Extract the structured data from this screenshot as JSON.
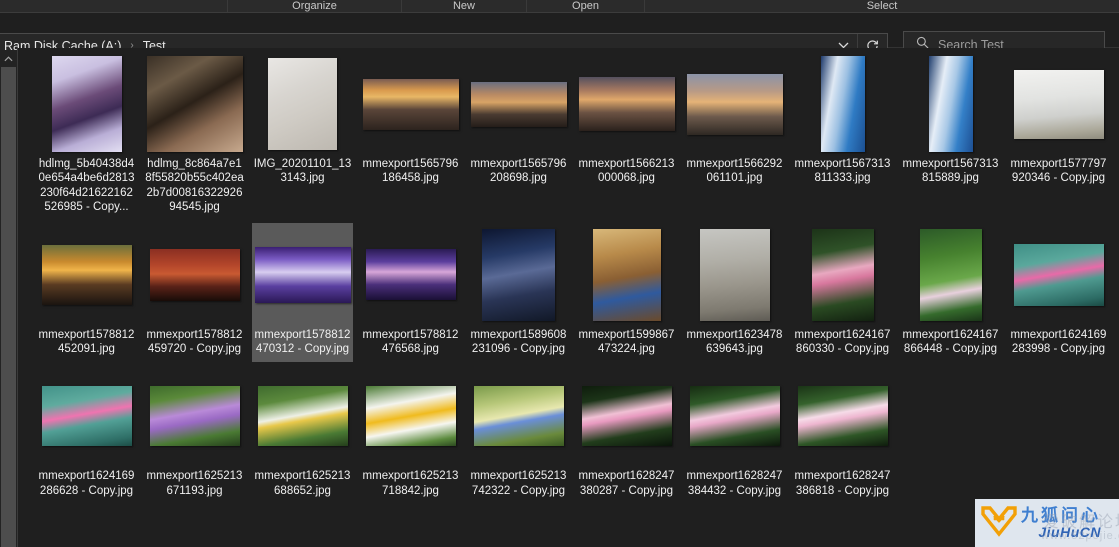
{
  "ribbon": {
    "groups": [
      {
        "label": "",
        "name": "ribbon-group-clipboard"
      },
      {
        "label": "Organize",
        "name": "ribbon-group-organize"
      },
      {
        "label": "New",
        "name": "ribbon-group-new"
      },
      {
        "label": "Open",
        "name": "ribbon-group-open"
      },
      {
        "label": "Select",
        "name": "ribbon-group-select"
      }
    ]
  },
  "address": {
    "crumbs": [
      "Ram Disk Cache (A:)",
      "Test"
    ],
    "separator": "›",
    "dropdown_icon": "chevron-down-icon",
    "dropdown_glyph": "⌄",
    "refresh_icon": "refresh-icon",
    "refresh_glyph": "↻"
  },
  "search": {
    "placeholder": "Search Test",
    "icon": "search-icon"
  },
  "scrollbar": {
    "up_glyph": "⌃"
  },
  "colors": {
    "window_bg": "#1f1f1f",
    "ribbon_bg": "#2b2b2b",
    "field_bg": "#272727",
    "field_border": "#4a4a4a",
    "text": "#f0f0f0",
    "placeholder": "#9b9b9b",
    "selection_bg": "#5a5a5a",
    "scroll_thumb": "#4d4d4d",
    "watermark_bg": "#dfe6ee",
    "watermark_blue": "#3f7fd0",
    "watermark_orange": "#f2a007"
  },
  "watermark": {
    "cn_text": "九狐问心",
    "en_text": "JiuHuCN",
    "ghost_text": "爱破解论坛",
    "ghost_text2": "www.52pojie.cn",
    "logo_icon": "fox-logo-icon"
  },
  "files": [
    {
      "name": "hdlmg_5b40438d40e654a4be6d2813230f64d21622162526985 - Copy...",
      "thumb": {
        "w": 70,
        "h": 96,
        "kind": "anime-girl"
      }
    },
    {
      "name": "hdlmg_8c864a7e18f55820b55c402ea2b7d0081632292694545.jpg",
      "thumb": {
        "w": 96,
        "h": 96,
        "kind": "cafe-woman"
      }
    },
    {
      "name": "IMG_20201101_133143.jpg",
      "thumb": {
        "w": 69,
        "h": 92,
        "kind": "dessert-plate"
      }
    },
    {
      "name": "mmexport1565796186458.jpg",
      "thumb": {
        "w": 96,
        "h": 51,
        "kind": "city-sunset-1"
      }
    },
    {
      "name": "mmexport1565796208698.jpg",
      "thumb": {
        "w": 96,
        "h": 45,
        "kind": "city-sunset-2"
      }
    },
    {
      "name": "mmexport1566213000068.jpg",
      "thumb": {
        "w": 96,
        "h": 54,
        "kind": "river-dusk"
      }
    },
    {
      "name": "mmexport1566292061101.jpg",
      "thumb": {
        "w": 96,
        "h": 61,
        "kind": "river-sun"
      }
    },
    {
      "name": "mmexport1567313811333.jpg",
      "thumb": {
        "w": 44,
        "h": 96,
        "kind": "waterfall-blue-1"
      }
    },
    {
      "name": "mmexport1567313815889.jpg",
      "thumb": {
        "w": 44,
        "h": 96,
        "kind": "waterfall-blue-2"
      }
    },
    {
      "name": "mmexport1577797920346 - Copy.jpg",
      "thumb": {
        "w": 90,
        "h": 69,
        "kind": "snow-tree"
      }
    },
    {
      "name": "mmexport1578812452091.jpg",
      "thumb": {
        "w": 90,
        "h": 60,
        "kind": "mountain-sunset"
      }
    },
    {
      "name": "mmexport1578812459720 - Copy.jpg",
      "thumb": {
        "w": 90,
        "h": 52,
        "kind": "red-sunset"
      }
    },
    {
      "name": "mmexport1578812470312 - Copy.jpg",
      "thumb": {
        "w": 96,
        "h": 56,
        "kind": "fireworks-purple"
      },
      "selected": true
    },
    {
      "name": "mmexport1578812476568.jpg",
      "thumb": {
        "w": 90,
        "h": 51,
        "kind": "fountain-night"
      }
    },
    {
      "name": "mmexport1589608231096 - Copy.jpg",
      "thumb": {
        "w": 73,
        "h": 92,
        "kind": "milky-way"
      }
    },
    {
      "name": "mmexport1599867473224.jpg",
      "thumb": {
        "w": 68,
        "h": 92,
        "kind": "autumn-girl"
      }
    },
    {
      "name": "mmexport1623478639643.jpg",
      "thumb": {
        "w": 70,
        "h": 92,
        "kind": "stone-statue"
      }
    },
    {
      "name": "mmexport1624167860330 - Copy.jpg",
      "thumb": {
        "w": 62,
        "h": 92,
        "kind": "lotus-bud"
      }
    },
    {
      "name": "mmexport1624167866448 - Copy.jpg",
      "thumb": {
        "w": 62,
        "h": 92,
        "kind": "lotus-leaves"
      }
    },
    {
      "name": "mmexport1624169283998 - Copy.jpg",
      "thumb": {
        "w": 90,
        "h": 62,
        "kind": "lotus-teal"
      }
    },
    {
      "name": "mmexport1624169286628 - Copy.jpg",
      "thumb": {
        "w": 90,
        "h": 60,
        "kind": "lotus-teal-2"
      }
    },
    {
      "name": "mmexport1625213671193.jpg",
      "thumb": {
        "w": 90,
        "h": 60,
        "kind": "purple-flowers"
      }
    },
    {
      "name": "mmexport1625213688652.jpg",
      "thumb": {
        "w": 90,
        "h": 60,
        "kind": "daisies-field"
      }
    },
    {
      "name": "mmexport1625213718842.jpg",
      "thumb": {
        "w": 90,
        "h": 60,
        "kind": "daisy-closeup"
      }
    },
    {
      "name": "mmexport1625213742322 - Copy.jpg",
      "thumb": {
        "w": 90,
        "h": 60,
        "kind": "yellow-meadow"
      }
    },
    {
      "name": "mmexport1628247380287 - Copy.jpg",
      "thumb": {
        "w": 90,
        "h": 60,
        "kind": "lotus-dark-1"
      }
    },
    {
      "name": "mmexport1628247384432 - Copy.jpg",
      "thumb": {
        "w": 90,
        "h": 60,
        "kind": "lotus-dark-2"
      }
    },
    {
      "name": "mmexport1628247386818 - Copy.jpg",
      "thumb": {
        "w": 90,
        "h": 60,
        "kind": "lotus-dark-3"
      }
    }
  ]
}
